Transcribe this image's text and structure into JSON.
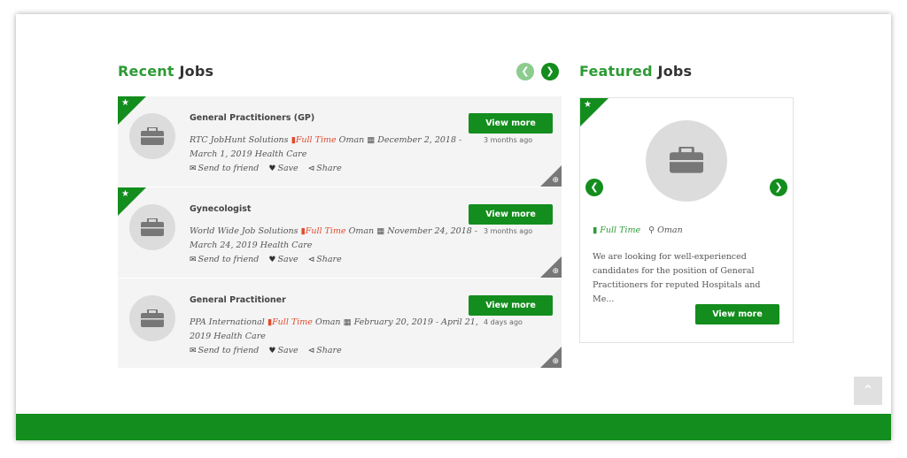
{
  "recent": {
    "title_accent": "Recent",
    "title_rest": "Jobs",
    "prev_icon": "chevron-left-icon",
    "next_icon": "chevron-right-icon",
    "jobs": [
      {
        "title": "General Practitioners (GP)",
        "company": "RTC JobHunt Solutions",
        "job_type": "Full Time",
        "location": "Oman",
        "dates": "December 2, 2018 - March 1, 2019",
        "category": "Health Care",
        "posted": "3 months ago",
        "view_label": "View more"
      },
      {
        "title": "Gynecologist",
        "company": "World Wide Job Solutions",
        "job_type": "Full Time",
        "location": "Oman",
        "dates": "November 24, 2018 - March 24, 2019",
        "category": "Health Care",
        "posted": "3 months ago",
        "view_label": "View more"
      },
      {
        "title": "General Practitioner",
        "company": "PPA International",
        "job_type": "Full Time",
        "location": "Oman",
        "dates": "February 20, 2019 - April 21, 2019",
        "category": "Health Care",
        "posted": "4 days ago",
        "view_label": "View more"
      }
    ],
    "actions": {
      "send": "Send to friend",
      "save": "Save",
      "share": "Share"
    }
  },
  "featured": {
    "title_accent": "Featured",
    "title_rest": "Jobs",
    "job_type": "Full Time",
    "location": "Oman",
    "description": "We are looking for well-experienced candidates for the position of General Practitioners for reputed Hospitals and Me...",
    "view_label": "View more"
  },
  "colors": {
    "brand_green": "#138d1d",
    "title_green": "#2e9a35",
    "full_time_red": "#e24b2f"
  }
}
